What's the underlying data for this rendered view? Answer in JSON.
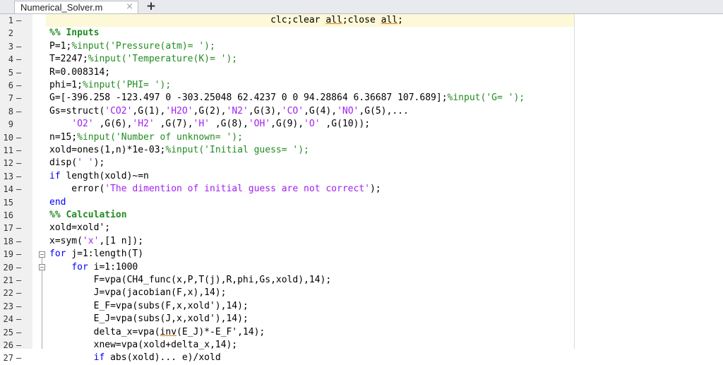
{
  "tab": {
    "title": "Numerical_Solver.m",
    "close_icon": "×",
    "add_icon": "+"
  },
  "lines": [
    {
      "n": "1",
      "d": "—",
      "code": "                                        clc;clear all;close all;"
    },
    {
      "n": "2",
      "d": "",
      "code": "%% Inputs"
    },
    {
      "n": "3",
      "d": "—",
      "code": "P=1;%input('Pressure(atm)= ');"
    },
    {
      "n": "4",
      "d": "—",
      "code": "T=2247;%input('Temperature(K)= ');"
    },
    {
      "n": "5",
      "d": "—",
      "code": "R=0.008314;"
    },
    {
      "n": "6",
      "d": "—",
      "code": "phi=1;%input('PHI= ');"
    },
    {
      "n": "7",
      "d": "—",
      "code": "G=[-396.258 -123.497 0 -303.25048 62.4237 0 0 94.28864 6.36687 107.689];%input('G= ');"
    },
    {
      "n": "8",
      "d": "—",
      "code": "Gs=struct('CO2',G(1),'H2O',G(2),'N2',G(3),'CO',G(4),'NO',G(5),..."
    },
    {
      "n": "9",
      "d": "",
      "code": "    'O2' ,G(6),'H2' ,G(7),'H' ,G(8),'OH',G(9),'O' ,G(10));"
    },
    {
      "n": "10",
      "d": "—",
      "code": "n=15;%input('Number of unknown= ');"
    },
    {
      "n": "11",
      "d": "—",
      "code": "xold=ones(1,n)*1e-03;%input('Initial guess= ');"
    },
    {
      "n": "12",
      "d": "—",
      "code": "disp(' ');"
    },
    {
      "n": "13",
      "d": "—",
      "code": "if length(xold)~=n"
    },
    {
      "n": "14",
      "d": "—",
      "code": "    error('The dimention of initial guess are not correct');"
    },
    {
      "n": "15",
      "d": "",
      "code": "end"
    },
    {
      "n": "16",
      "d": "",
      "code": "%% Calculation"
    },
    {
      "n": "17",
      "d": "—",
      "code": "xold=xold';"
    },
    {
      "n": "18",
      "d": "—",
      "code": "x=sym('x',[1 n]);"
    },
    {
      "n": "19",
      "d": "—",
      "code": "for j=1:length(T)"
    },
    {
      "n": "20",
      "d": "—",
      "code": "    for i=1:1000"
    },
    {
      "n": "21",
      "d": "—",
      "code": "        F=vpa(CH4_func(x,P,T(j),R,phi,Gs,xold),14);"
    },
    {
      "n": "22",
      "d": "—",
      "code": "        J=vpa(jacobian(F,x),14);"
    },
    {
      "n": "23",
      "d": "—",
      "code": "        E_F=vpa(subs(F,x,xold'),14);"
    },
    {
      "n": "24",
      "d": "—",
      "code": "        E_J=vpa(subs(J,x,xold'),14);"
    },
    {
      "n": "25",
      "d": "—",
      "code": "        delta_x=vpa(inv(E_J)*-E_F',14);"
    },
    {
      "n": "26",
      "d": "—",
      "code": "        xnew=vpa(xold+delta_x,14);"
    },
    {
      "n": "27",
      "d": "—",
      "code": "        if abs(xold)... e)/xold"
    }
  ]
}
